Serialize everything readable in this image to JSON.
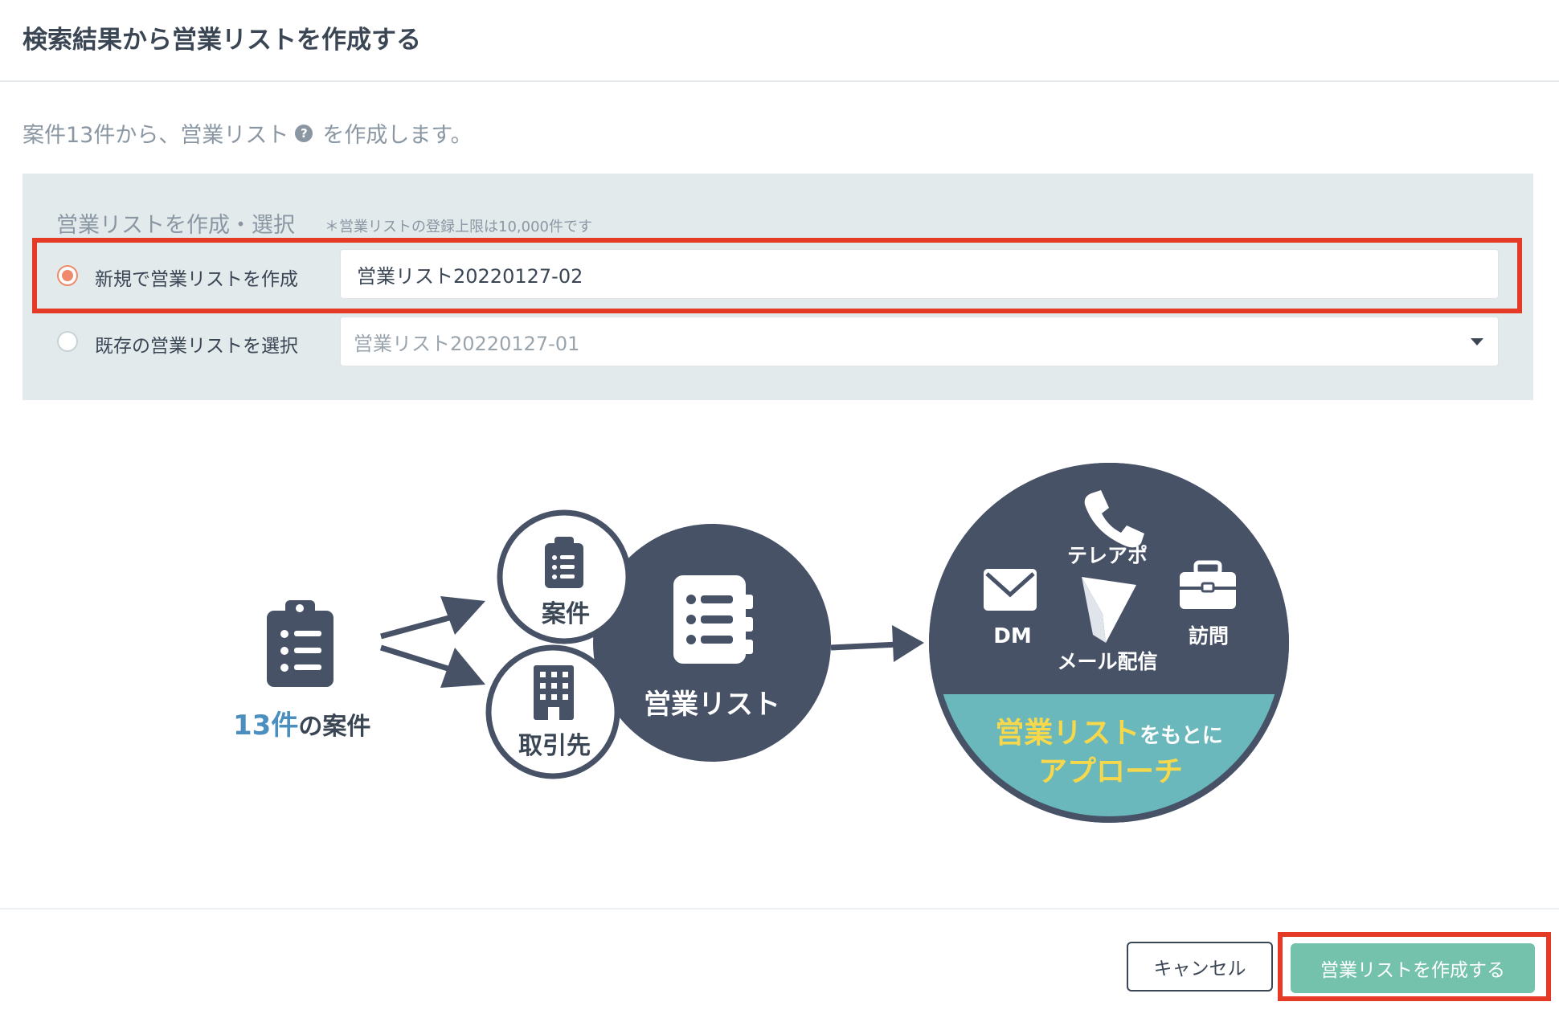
{
  "dialog": {
    "title": "検索結果から営業リストを作成する",
    "intro_before": "案件13件から、営業リスト",
    "intro_after": "を作成します。",
    "help_icon": "?"
  },
  "list_panel": {
    "label": "営業リストを作成・選択",
    "note": "＊営業リストの登録上限は10,000件です",
    "options": [
      {
        "label": "新規で営業リストを作成",
        "value": "営業リスト20220127-02",
        "selected": true
      },
      {
        "label": "既存の営業リストを選択",
        "value": "営業リスト20220127-01",
        "selected": false
      }
    ]
  },
  "illustration": {
    "source_count": "13件",
    "source_suffix": "の案件",
    "bubble_deals": "案件",
    "bubble_clients": "取引先",
    "center": "営業リスト",
    "telemarketing": "テレアポ",
    "dm": "DM",
    "visit": "訪問",
    "email": "メール配信",
    "approach_highlight": "営業リスト",
    "approach_small": "をもとに",
    "approach_line2": "アプローチ"
  },
  "footer": {
    "cancel_label": "キャンセル",
    "create_label": "営業リストを作成する"
  },
  "colors": {
    "navy": "#475267",
    "teal": "#6bb8bc",
    "yellow": "#f6d84a",
    "blue": "#4a8fc0",
    "radio_selected": "#ef8a6d",
    "primary_button": "#74c2ab",
    "highlight": "#e53b26"
  }
}
